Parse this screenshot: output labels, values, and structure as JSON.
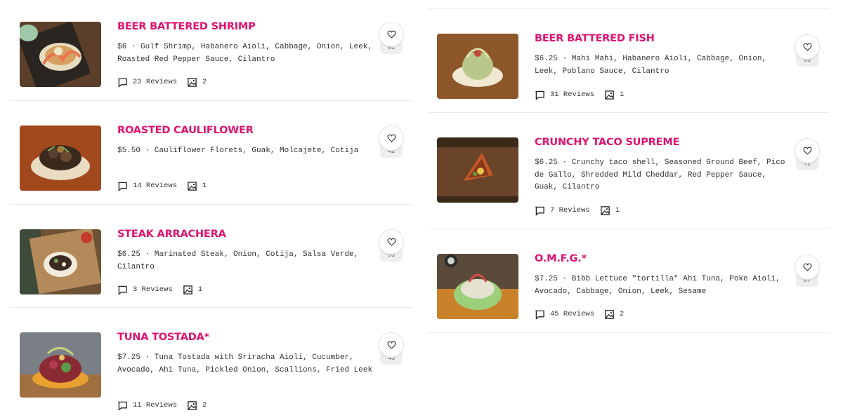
{
  "colors": {
    "accent": "#e0136f",
    "divider": "#ebebeb"
  },
  "icons": {
    "reviews": "comment-icon",
    "photos": "image-icon",
    "favorite": "heart-icon"
  },
  "left_items": [
    {
      "title": "BEER BATTERED SHRIMP",
      "description": "$6 · Gulf Shrimp, Habanero Aioli, Cabbage, Onion, Leek, Roasted Red Pepper Sauce, Cilantro",
      "reviews": "23 Reviews",
      "photos": "2",
      "likes": "81"
    },
    {
      "title": "ROASTED CAULIFLOWER",
      "description": "$5.50 · Cauliflower Florets, Guak, Molcajete, Cotija",
      "reviews": "14 Reviews",
      "photos": "1",
      "likes": "42"
    },
    {
      "title": "STEAK ARRACHERA",
      "description": "$6.25 · Marinated Steak, Onion, Cotija, Salsa Verde, Cilantro",
      "reviews": "3 Reviews",
      "photos": "1",
      "likes": "53"
    },
    {
      "title": "TUNA TOSTADA*",
      "description": "$7.25 · Tuna Tostada with Sriracha Aioli, Cucumber, Avocado, Ahi Tuna, Pickled Onion, Scallions, Fried Leek",
      "reviews": "11 Reviews",
      "photos": "2",
      "likes": "43"
    }
  ],
  "right_items": [
    {
      "title": "BEER BATTERED FISH",
      "description": "$6.25 · Mahi Mahi, Habanero Aioli, Cabbage, Onion, Leek, Poblano Sauce, Cilantro",
      "reviews": "31 Reviews",
      "photos": "1",
      "likes": "53"
    },
    {
      "title": "CRUNCHY TACO SUPREME",
      "description": "$6.25 · Crunchy taco shell, Seasoned Ground Beef, Pico de Gallo, Shredded Mild Cheddar, Red Pepper Sauce, Guak, Cilantro",
      "reviews": "7 Reviews",
      "photos": "1",
      "likes": "72"
    },
    {
      "title": "O.M.F.G.*",
      "description": "$7.25 · Bibb Lettuce \"tortilla\" Ahi Tuna, Poke Aioli, Avocado, Cabbage, Onion, Leek, Sesame",
      "reviews": "45 Reviews",
      "photos": "2",
      "likes": "87"
    }
  ]
}
